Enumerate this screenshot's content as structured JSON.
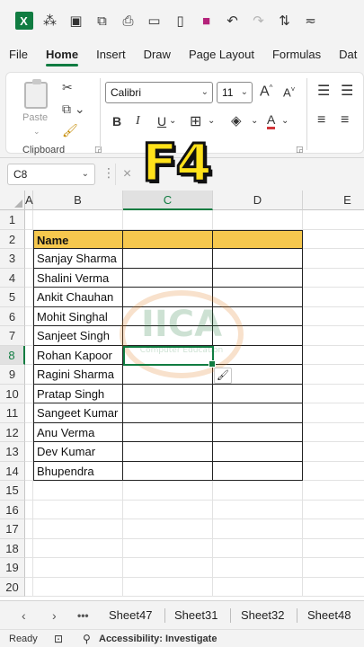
{
  "app": {
    "name": "Excel"
  },
  "qat": {
    "icons": [
      "excel-logo",
      "spell-icon",
      "camera-icon",
      "share-icon",
      "print-preview-icon",
      "open-folder-icon",
      "new-file-icon",
      "save-icon",
      "undo-icon",
      "redo-icon",
      "sort-icon",
      "customize-icon"
    ]
  },
  "tabs": [
    "File",
    "Home",
    "Insert",
    "Draw",
    "Page Layout",
    "Formulas",
    "Dat"
  ],
  "active_tab": "Home",
  "ribbon": {
    "paste_label": "Paste",
    "clipboard_label": "Clipboard",
    "font_name": "Calibri",
    "font_size": "11",
    "bold": "B",
    "italic": "I",
    "underline": "U",
    "grow_font": "A",
    "shrink_font": "A",
    "font_color_letter": "A"
  },
  "formula_bar": {
    "name_box": "C8",
    "cancel": "×"
  },
  "overlay": {
    "text": "F4"
  },
  "columns": [
    "A",
    "B",
    "C",
    "D",
    "E"
  ],
  "selected_column": "C",
  "rows": [
    "1",
    "2",
    "3",
    "4",
    "5",
    "6",
    "7",
    "8",
    "9",
    "10",
    "11",
    "12",
    "13",
    "14",
    "15",
    "16",
    "17",
    "18",
    "19",
    "20"
  ],
  "selected_row": "8",
  "table": {
    "header": "Name",
    "names": [
      "Sanjay Sharma",
      "Shalini Verma",
      "Ankit Chauhan",
      "Mohit Singhal",
      "Sanjeet Singh",
      "Rohan Kapoor",
      "Ragini Sharma",
      "Pratap Singh",
      "Sangeet Kumar",
      "Anu Verma",
      "Dev Kumar",
      "Bhupendra"
    ]
  },
  "watermark": {
    "text": "IICA",
    "sub": "Computer Education"
  },
  "sheets": {
    "more": "•••",
    "tabs": [
      "Sheet47",
      "Sheet31",
      "Sheet32",
      "Sheet48"
    ]
  },
  "status": {
    "ready": "Ready",
    "accessibility": "Accessibility: Investigate"
  },
  "colors": {
    "accent": "#107c41",
    "header_fill": "#f6c84e",
    "overlay_fill": "#ffe11a",
    "save": "#b4227a",
    "font_color": "#d13438"
  }
}
